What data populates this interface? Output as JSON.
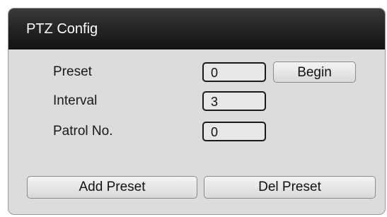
{
  "dialog": {
    "title": "PTZ Config"
  },
  "fields": {
    "preset": {
      "label": "Preset",
      "value": "0"
    },
    "interval": {
      "label": "Interval",
      "value": "3"
    },
    "patrol": {
      "label": "Patrol No.",
      "value": "0"
    }
  },
  "buttons": {
    "begin": "Begin",
    "add_preset": "Add Preset",
    "del_preset": "Del Preset"
  }
}
